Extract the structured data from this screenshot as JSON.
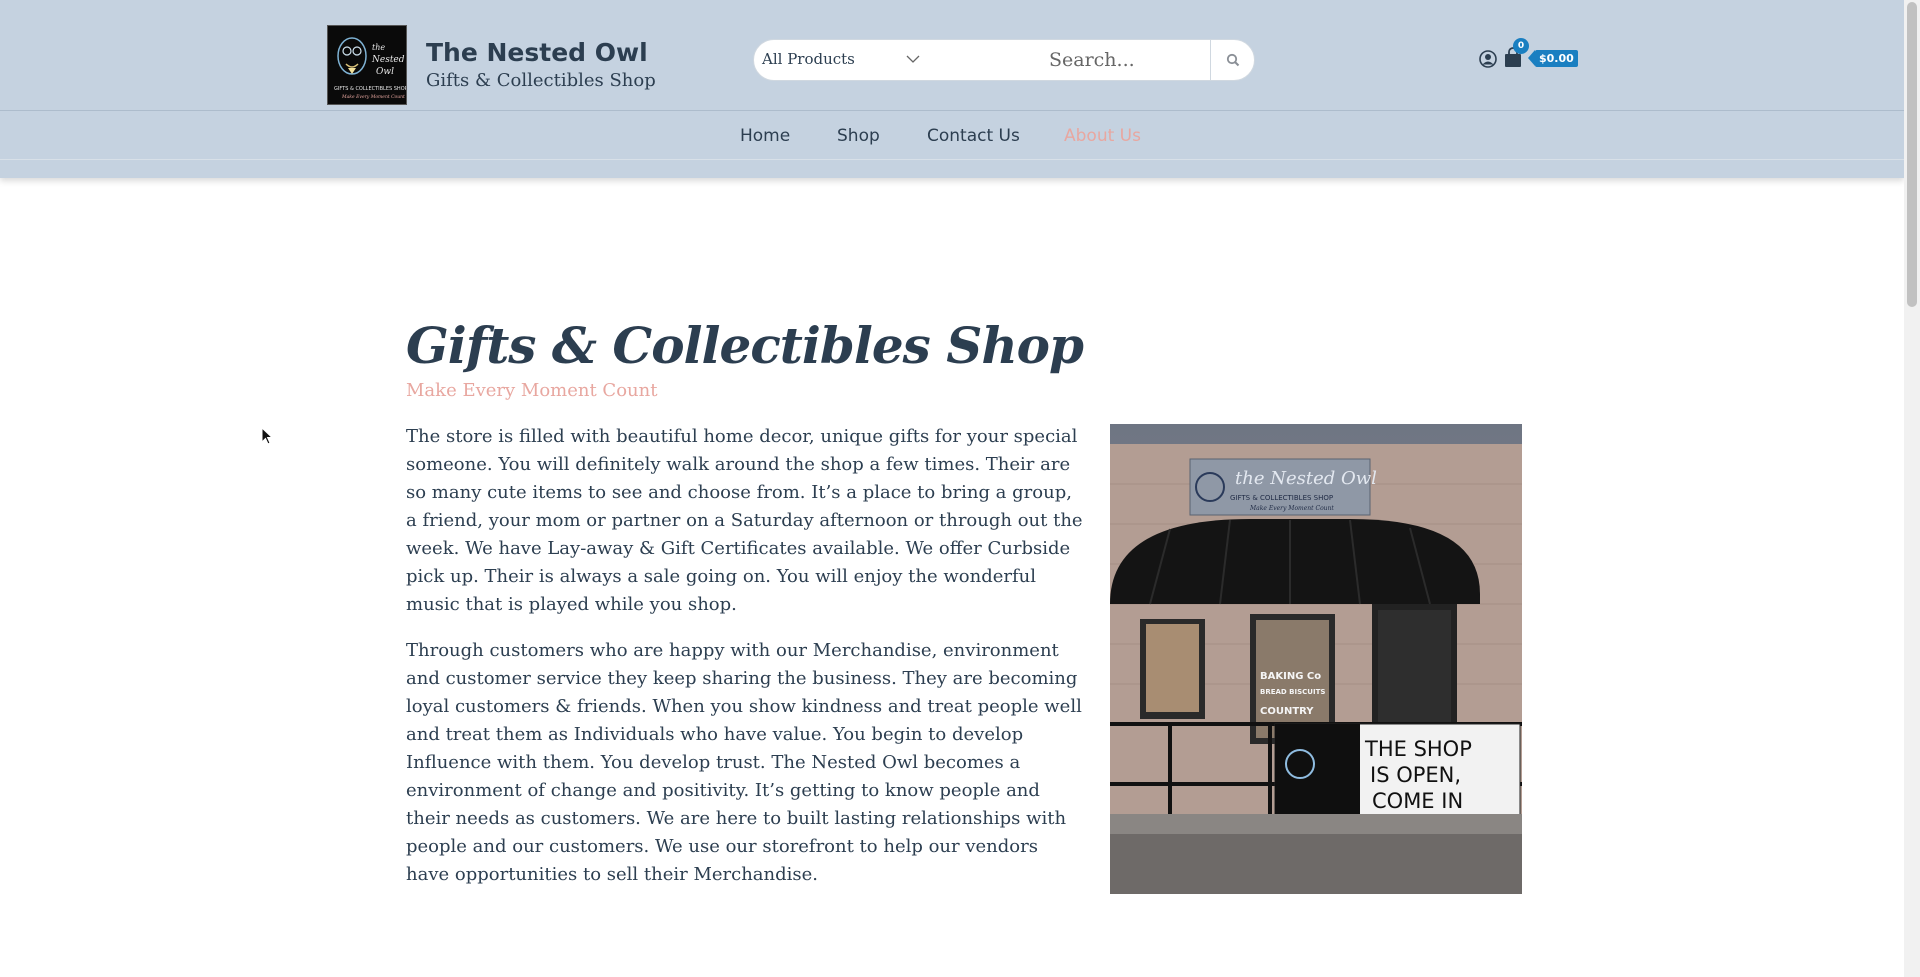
{
  "header": {
    "brand_name": "The Nested Owl",
    "brand_tagline": "Gifts & Collectibles Shop",
    "logo_icon": "owl-logo-icon"
  },
  "search": {
    "category": "All Products",
    "placeholder": "Search..."
  },
  "cart": {
    "count": "0",
    "total": "$0.00"
  },
  "nav": {
    "items": [
      {
        "label": "Home"
      },
      {
        "label": "Shop"
      },
      {
        "label": "Contact Us"
      },
      {
        "label": "About Us"
      }
    ],
    "active": "About Us"
  },
  "content": {
    "title": "Gifts & Collectibles Shop",
    "subtitle": "Make Every Moment Count",
    "paragraph1": "The store is filled with beautiful home decor, unique gifts for your special someone. You will definitely walk around the shop a few times. Their are so many cute items to see and choose from. It’s a place to bring a group, a friend, your mom or partner on a Saturday afternoon or through out the week. We have Lay-away & Gift Certificates available. We offer Curbside pick up. Their is always a sale going on. You will enjoy the wonderful music that is played while you shop.",
    "paragraph2": "Through customers who are happy with our Merchandise, environment and customer service they keep sharing the business. They are becoming loyal customers & friends. When you show kindness and treat people well and treat them as Individuals who have value. You begin to develop Influence with them. You develop trust. The Nested Owl becomes a environment of change and positivity. It’s getting to know people and their needs as customers. We are here to built lasting relationships with people and our customers. We use our storefront to help our vendors have opportunities to sell their Merchandise."
  },
  "storefront_photo": {
    "sign_name": "the Nested Owl",
    "sign_sub": "GIFTS & COLLECTIBLES SHOP",
    "sign_motto": "Make Every Moment Count",
    "banner_line1": "THE SHOP",
    "banner_line2": "IS OPEN,",
    "banner_line3": "COME IN",
    "window_text1": "BAKING Co",
    "window_text2": "BREAD BISCUITS",
    "window_text3": "COUNTRY"
  },
  "colors": {
    "header_bg": "#c5d2e0",
    "text": "#2c3e50",
    "accent_pink": "#e8a7a0",
    "cart_blue": "#1a7fc1"
  }
}
